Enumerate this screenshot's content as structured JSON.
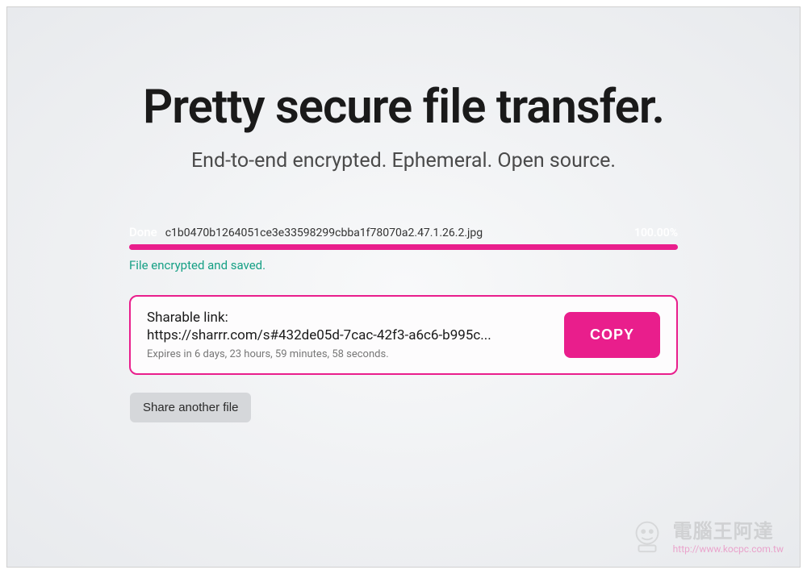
{
  "header": {
    "title": "Pretty secure file transfer.",
    "subtitle": "End-to-end encrypted. Ephemeral. Open source."
  },
  "progress": {
    "done_label": "Done",
    "filename": "c1b0470b1264051ce3e33598299cbba1f78070a2.47.1.26.2.jpg",
    "percent": "100.00%",
    "status_message": "File encrypted and saved."
  },
  "share": {
    "label": "Sharable link:",
    "link": "https://sharrr.com/s#432de05d-7cac-42f3-a6c6-b995c...",
    "expiry": "Expires in 6 days, 23 hours, 59 minutes, 58 seconds.",
    "copy_button": "COPY"
  },
  "actions": {
    "share_another": "Share another file"
  },
  "watermark": {
    "title": "電腦王阿達",
    "url": "http://www.kocpc.com.tw"
  },
  "colors": {
    "accent": "#e91e8c",
    "success": "#16a085"
  }
}
